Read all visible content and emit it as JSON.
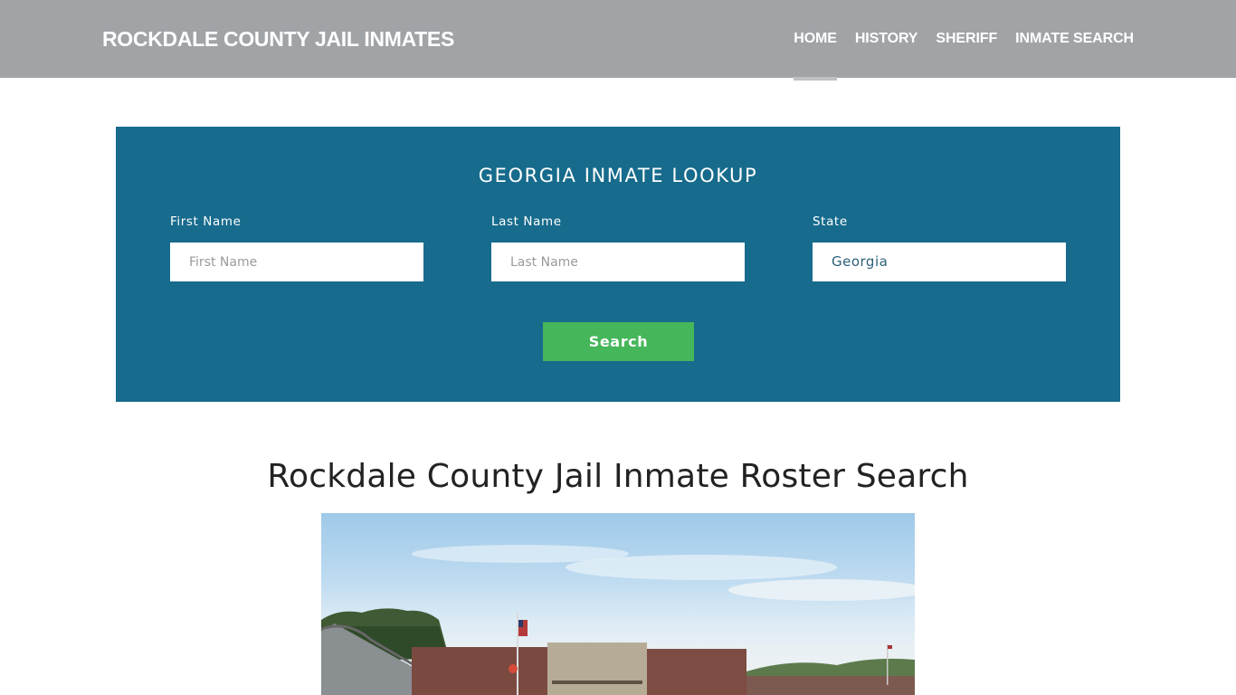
{
  "header": {
    "brand": "ROCKDALE COUNTY JAIL INMATES",
    "nav": [
      {
        "label": "HOME",
        "active": true
      },
      {
        "label": "HISTORY",
        "active": false
      },
      {
        "label": "SHERIFF",
        "active": false
      },
      {
        "label": "INMATE SEARCH",
        "active": false
      }
    ]
  },
  "lookup": {
    "title": "GEORGIA INMATE LOOKUP",
    "first_name": {
      "label": "First Name",
      "placeholder": "First Name",
      "value": ""
    },
    "last_name": {
      "label": "Last Name",
      "placeholder": "Last Name",
      "value": ""
    },
    "state": {
      "label": "State",
      "value": "Georgia"
    },
    "search_label": "Search"
  },
  "main": {
    "title": "Rockdale County Jail Inmate Roster Search",
    "image_alt": "Rockdale County Jail building exterior"
  },
  "colors": {
    "navbar": "#a0a4a7",
    "lookup_bg": "#176b8c",
    "search_button": "#45b65a"
  }
}
